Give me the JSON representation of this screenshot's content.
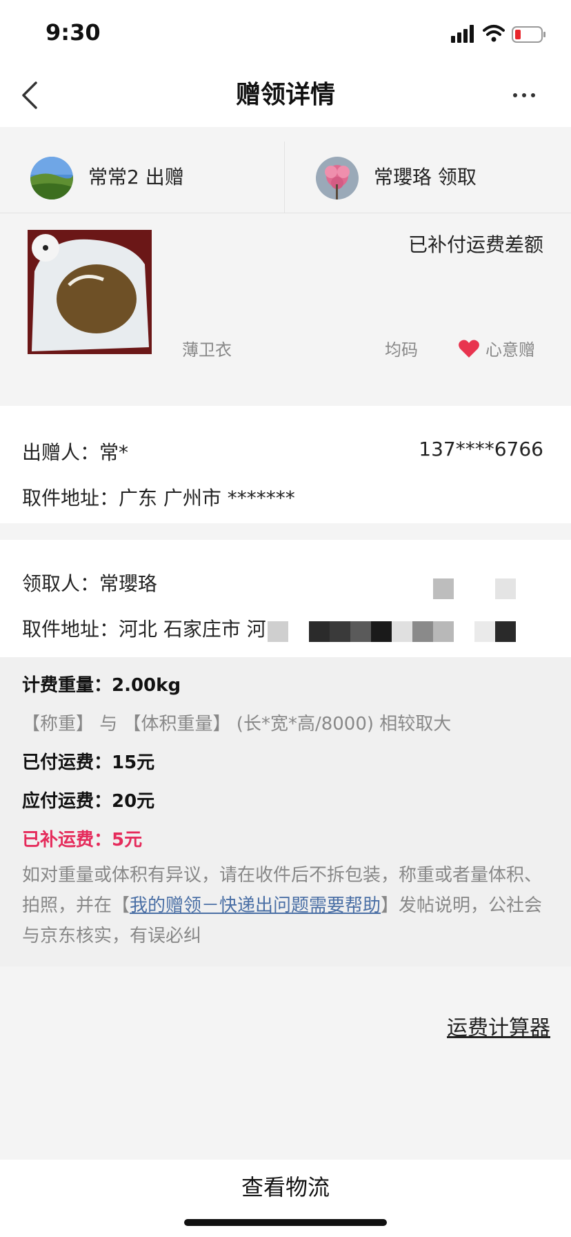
{
  "status_bar": {
    "time": "9:30"
  },
  "nav": {
    "title": "赠领详情"
  },
  "gift": {
    "giver_label": "常常2 出赠",
    "receiver_label": "常瓔珞 领取",
    "supplement_status": "已补付运费差额",
    "item_name": "薄卫衣",
    "item_size": "均码",
    "gift_type": "心意赠"
  },
  "giver": {
    "name_label": "出赠人：常*",
    "phone": "137****6766",
    "address": "取件地址：广东 广州市 *******"
  },
  "receiver": {
    "name_label": "领取人：常瓔珞",
    "address": "取件地址：河北 石家庄市 河"
  },
  "fees": {
    "weight": "计费重量：2.00kg",
    "weight_rule": "【称重】 与 【体积重量】 (长*宽*高/8000) 相较取大",
    "paid": "已付运费：15元",
    "payable": "应付运费：20元",
    "supplemented": "已补运费：5元",
    "note_prefix": "如对重量或体积有异议，请在收件后不拆包装，称重或者量体积、拍照，并在【",
    "note_link": "我的赠领－快递出问题需要帮助",
    "note_suffix": "】发帖说明，公社会与京东核实，有误必纠"
  },
  "calculator": {
    "label": "运费计算器"
  },
  "bottom": {
    "track_label": "查看物流"
  },
  "colors": {
    "accent_red": "#e52b5b",
    "link_blue": "#4a6fa5"
  }
}
